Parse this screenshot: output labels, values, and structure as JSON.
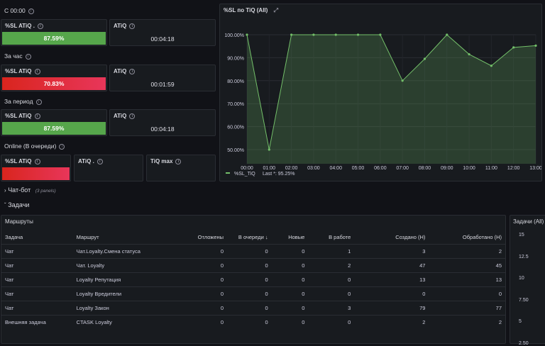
{
  "sections": {
    "s1": "С 00:00",
    "s2": "За час",
    "s3": "За период",
    "s4": "Online (В очереди)"
  },
  "stats": {
    "r1": {
      "sl_title": "%SL ATiQ .",
      "sl_value": "87.59%",
      "atiq_title": "ATiQ",
      "atiq_value": "00:04:18"
    },
    "r2": {
      "sl_title": "%SL ATiQ",
      "sl_value": "70.83%",
      "atiq_title": "ATiQ",
      "atiq_value": "00:01:59"
    },
    "r3": {
      "sl_title": "%SL ATiQ",
      "sl_value": "87.59%",
      "atiq_title": "ATiQ",
      "atiq_value": "00:04:18"
    },
    "r4": {
      "sl_title": "%SL ATiQ",
      "atiq_title": "ATiQ .",
      "tiq_title": "TiQ max"
    }
  },
  "colors": {
    "green": "#56a64b",
    "red": "#e02f44",
    "line": "#73bf69"
  },
  "chart_panel": {
    "title": "%SL по TiQ (All)",
    "legend_name": "%SL_TiQ",
    "legend_last": "Last *: 95.25%"
  },
  "chart_data": {
    "type": "area",
    "x": [
      "00:00",
      "01:00",
      "02:00",
      "03:00",
      "04:00",
      "05:00",
      "06:00",
      "07:00",
      "08:00",
      "09:00",
      "10:00",
      "11:00",
      "12:00",
      "13:00"
    ],
    "series": [
      {
        "name": "%SL_TiQ",
        "values": [
          100,
          50,
          100,
          100,
          100,
          100,
          100,
          80,
          89.5,
          100,
          91.5,
          86.5,
          94.5,
          95.25
        ]
      }
    ],
    "y_ticks": [
      "100.00%",
      "90.00%",
      "80.00%",
      "70.00%",
      "60.00%",
      "50.00%"
    ],
    "ylim": [
      50,
      100
    ],
    "legend": "bottom-left"
  },
  "rows": {
    "chatbot": {
      "label": "Чат-бот",
      "note": "(3 panels)"
    },
    "tasks": {
      "label": "Задачи"
    }
  },
  "routes": {
    "title": "Маршруты",
    "columns": [
      "Задача",
      "Маршрут",
      "Отложены",
      "В очереди ↓",
      "Новые",
      "В работе",
      "Создано (Н)",
      "Обработано (Н)"
    ],
    "rows": [
      [
        "Чат",
        "Чат.Loyalty.Смена статуса",
        "0",
        "0",
        "0",
        "1",
        "3",
        "2"
      ],
      [
        "Чат",
        "Чат. Loyalty",
        "0",
        "0",
        "0",
        "2",
        "47",
        "45"
      ],
      [
        "Чат",
        "Loyalty Репутация",
        "0",
        "0",
        "0",
        "0",
        "13",
        "13"
      ],
      [
        "Чат",
        "Loyalty Вредители",
        "0",
        "0",
        "0",
        "0",
        "0",
        "0"
      ],
      [
        "Чат",
        "Loyalty Закон",
        "0",
        "0",
        "0",
        "3",
        "79",
        "77"
      ],
      [
        "Внешняя задача",
        "CTASK Loyalty",
        "0",
        "0",
        "0",
        "0",
        "2",
        "2"
      ]
    ]
  },
  "tasks_chart": {
    "title": "Задачи (All)",
    "ticks": [
      "15",
      "12.5",
      "10",
      "7.50",
      "5",
      "2.50"
    ]
  }
}
